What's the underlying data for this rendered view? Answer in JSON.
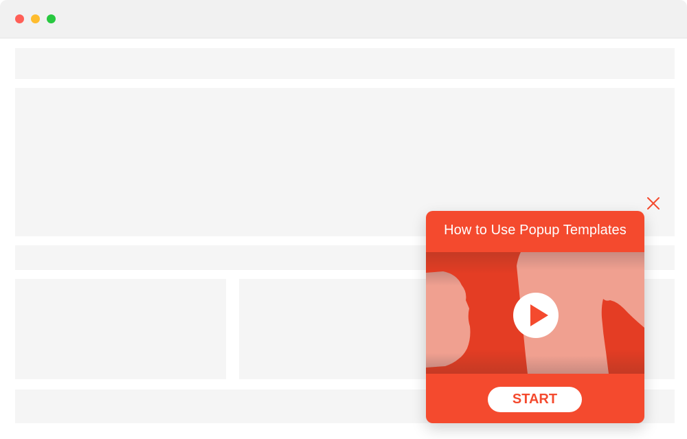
{
  "window": {
    "controls": [
      {
        "name": "close",
        "color": "#ff5f57"
      },
      {
        "name": "minimize",
        "color": "#febc2e"
      },
      {
        "name": "maximize",
        "color": "#28c840"
      }
    ]
  },
  "popup": {
    "title": "How to Use Popup Templates",
    "start_label": "START",
    "close_icon": "close-icon",
    "video_icon": "play-icon",
    "accent_color": "#f44a2e"
  }
}
